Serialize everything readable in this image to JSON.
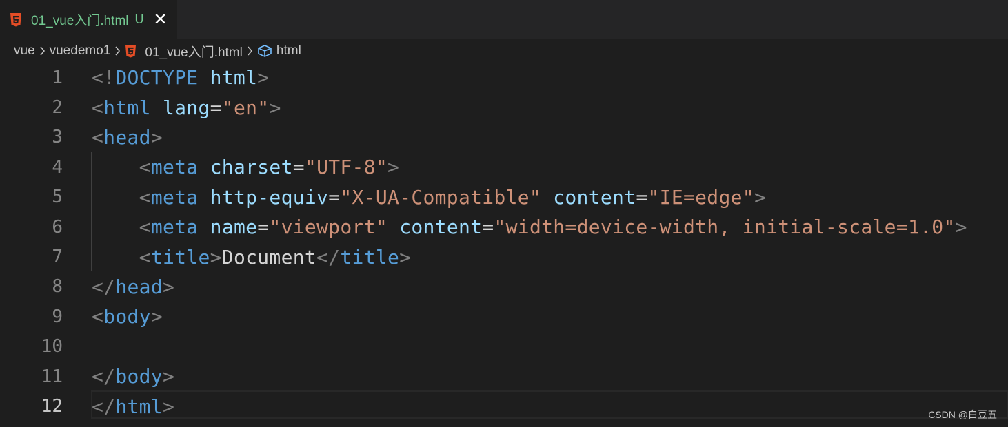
{
  "tab": {
    "filename": "01_vue入门.html",
    "status": "U",
    "close": "✕",
    "icon": "html5-icon"
  },
  "breadcrumb": [
    "vue",
    "vuedemo1",
    "01_vue入门.html",
    "html"
  ],
  "lines": [
    {
      "n": "1",
      "html": "<span class='p'>&lt;!</span><span class='t'>DOCTYPE</span> <span class='a'>html</span><span class='p'>&gt;</span>"
    },
    {
      "n": "2",
      "html": "<span class='p'>&lt;</span><span class='t'>html</span> <span class='a'>lang</span><span class='x'>=</span><span class='s'>\"en\"</span><span class='p'>&gt;</span>"
    },
    {
      "n": "3",
      "html": "<span class='p'>&lt;</span><span class='t'>head</span><span class='p'>&gt;</span>"
    },
    {
      "n": "4",
      "html": "    <span class='p'>&lt;</span><span class='t'>meta</span> <span class='a'>charset</span><span class='x'>=</span><span class='s'>\"UTF-8\"</span><span class='p'>&gt;</span>"
    },
    {
      "n": "5",
      "html": "    <span class='p'>&lt;</span><span class='t'>meta</span> <span class='a'>http-equiv</span><span class='x'>=</span><span class='s'>\"X-UA-Compatible\"</span> <span class='a'>content</span><span class='x'>=</span><span class='s'>\"IE=edge\"</span><span class='p'>&gt;</span>"
    },
    {
      "n": "6",
      "html": "    <span class='p'>&lt;</span><span class='t'>meta</span> <span class='a'>name</span><span class='x'>=</span><span class='s'>\"viewport\"</span> <span class='a'>content</span><span class='x'>=</span><span class='s'>\"width=device-width, initial-scale=1.0\"</span><span class='p'>&gt;</span>"
    },
    {
      "n": "7",
      "html": "    <span class='p'>&lt;</span><span class='t'>title</span><span class='p'>&gt;</span><span class='x'>Document</span><span class='p'>&lt;/</span><span class='t'>title</span><span class='p'>&gt;</span>"
    },
    {
      "n": "8",
      "html": "<span class='p'>&lt;/</span><span class='t'>head</span><span class='p'>&gt;</span>"
    },
    {
      "n": "9",
      "html": "<span class='p'>&lt;</span><span class='t'>body</span><span class='p'>&gt;</span>"
    },
    {
      "n": "10",
      "html": ""
    },
    {
      "n": "11",
      "html": "<span class='p'>&lt;/</span><span class='t'>body</span><span class='p'>&gt;</span>"
    },
    {
      "n": "12",
      "html": "<span class='p'>&lt;/</span><span class='t'>html</span><span class='p'>&gt;</span>",
      "active": true
    }
  ],
  "watermark": "CSDN @白豆五",
  "colors": {
    "background": "#1e1e1e",
    "tag": "#569cd6",
    "attribute": "#9cdcfe",
    "string": "#ce9178",
    "punctuation": "#808080",
    "untracked": "#73c991"
  }
}
